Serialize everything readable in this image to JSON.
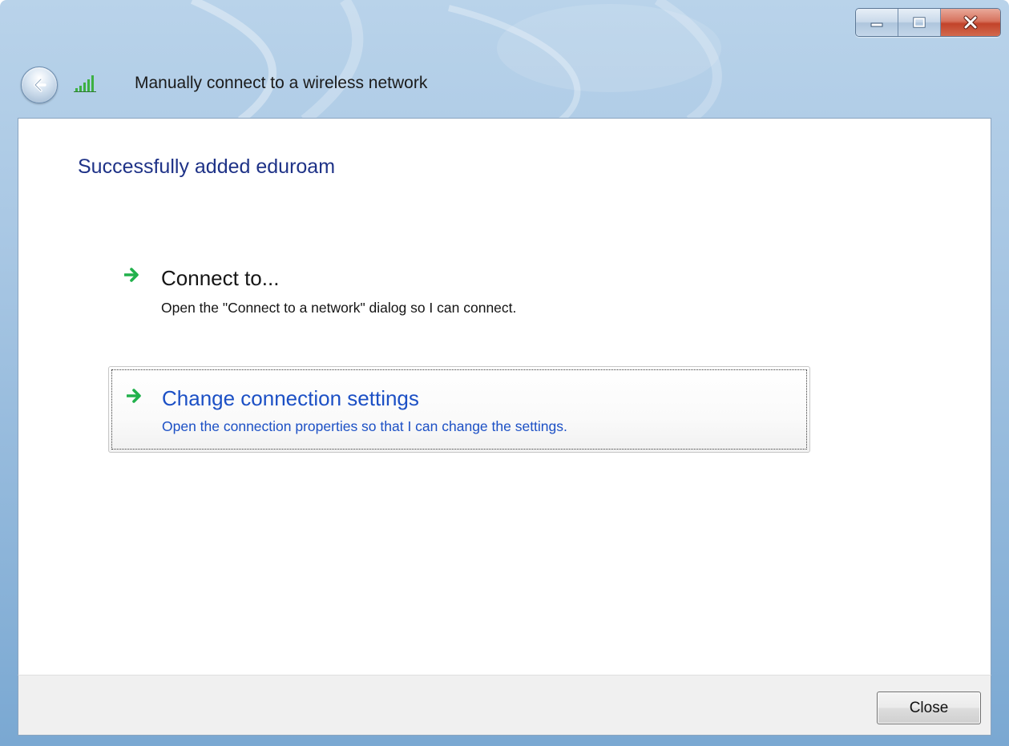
{
  "window": {
    "title": "Manually connect to a wireless network",
    "caption_buttons": {
      "minimize_icon": "minimize-icon",
      "maximize_icon": "maximize-icon",
      "close_icon": "close-icon"
    },
    "back_icon": "back-arrow-icon",
    "network_icon": "wireless-signal-icon"
  },
  "main": {
    "heading": "Successfully added eduroam",
    "options": [
      {
        "title": "Connect to...",
        "description": "Open the \"Connect to a network\" dialog so I can connect.",
        "icon": "green-arrow-icon"
      },
      {
        "title": "Change connection settings",
        "description": "Open the connection properties so that I can change the settings.",
        "icon": "green-arrow-icon"
      }
    ]
  },
  "footer": {
    "close_label": "Close"
  },
  "colors": {
    "heading": "#1e3287",
    "link_hover": "#1c50c5",
    "arrow_green": "#22b14c",
    "frame_blue": "#a7c6e3"
  }
}
